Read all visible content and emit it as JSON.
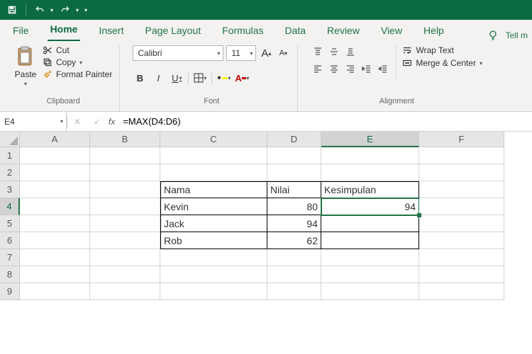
{
  "qat": {
    "undo_tip": "Undo",
    "redo_tip": "Redo"
  },
  "tabs": {
    "file": "File",
    "home": "Home",
    "insert": "Insert",
    "pagelayout": "Page Layout",
    "formulas": "Formulas",
    "data": "Data",
    "review": "Review",
    "view": "View",
    "help": "Help",
    "tellme": "Tell m"
  },
  "ribbon": {
    "clipboard": {
      "paste": "Paste",
      "cut": "Cut",
      "copy": "Copy",
      "format_painter": "Format Painter",
      "label": "Clipboard"
    },
    "font": {
      "name": "Calibri",
      "size": "11",
      "bold": "B",
      "italic": "I",
      "underline": "U",
      "label": "Font"
    },
    "alignment": {
      "wrap": "Wrap Text",
      "merge": "Merge & Center",
      "label": "Alignment"
    }
  },
  "fbar": {
    "cellref": "E4",
    "formula": "=MAX(D4:D6)",
    "fx": "fx"
  },
  "columns": [
    "A",
    "B",
    "C",
    "D",
    "E",
    "F"
  ],
  "rows": [
    "1",
    "2",
    "3",
    "4",
    "5",
    "6",
    "7",
    "8",
    "9"
  ],
  "table": {
    "head": {
      "nama": "Nama",
      "nilai": "Nilai",
      "kesimpulan": "Kesimpulan"
    },
    "rows": [
      {
        "nama": "Kevin",
        "nilai": "80"
      },
      {
        "nama": "Jack",
        "nilai": "94"
      },
      {
        "nama": "Rob",
        "nilai": "62"
      }
    ],
    "kesimpulan_value": "94"
  },
  "chart_data": {
    "type": "table",
    "columns": [
      "Nama",
      "Nilai",
      "Kesimpulan"
    ],
    "rows": [
      [
        "Kevin",
        80,
        94
      ],
      [
        "Jack",
        94,
        null
      ],
      [
        "Rob",
        62,
        null
      ]
    ],
    "note": "E4 contains =MAX(D4:D6) → 94"
  }
}
